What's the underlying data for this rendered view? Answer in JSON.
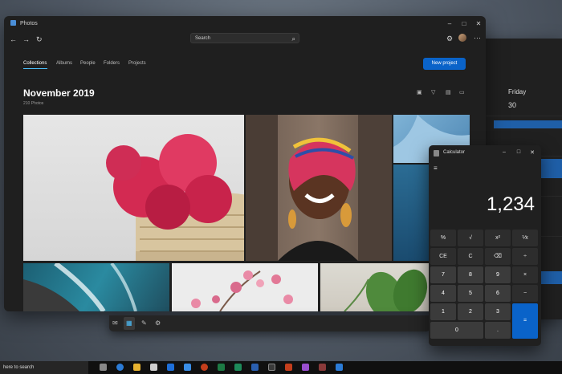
{
  "calendar": {
    "day": "Friday",
    "date": "30"
  },
  "photos": {
    "title_bar": "Photos",
    "search_placeholder": "Search",
    "tabs": [
      "Collections",
      "Albums",
      "People",
      "Folders",
      "Projects"
    ],
    "new_project": "New project",
    "heading": "November 2019",
    "count": "210 Photos"
  },
  "calculator": {
    "title": "Calculator",
    "display": "1,234",
    "keys": [
      "%",
      "√",
      "x²",
      "⅟x",
      "CE",
      "C",
      "⌫",
      "÷",
      "7",
      "8",
      "9",
      "×",
      "4",
      "5",
      "6",
      "−",
      "1",
      "2",
      "3",
      "+",
      "0",
      ".",
      "="
    ]
  },
  "taskbar": {
    "search_text": "here to search"
  },
  "icons": {
    "photos_app": "photos-icon",
    "calc_app": "calculator-icon",
    "settings": "gear-icon",
    "more": "ellipsis-icon"
  },
  "colors": {
    "accent": "#0a63c9",
    "tab_underline": "#4cc2ff"
  }
}
